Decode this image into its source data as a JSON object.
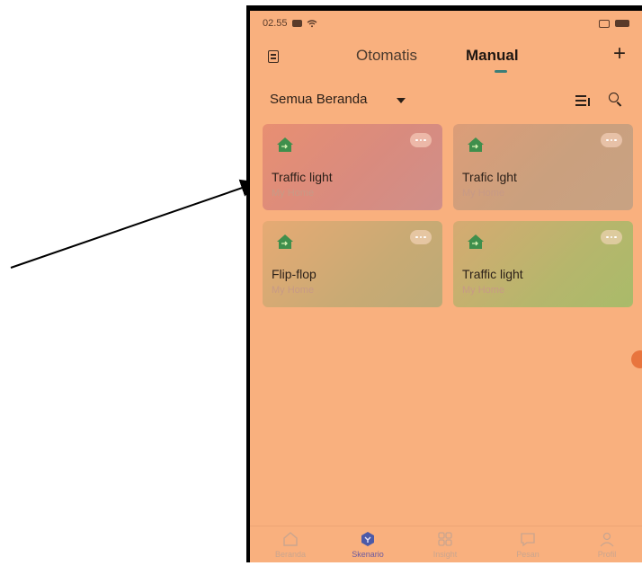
{
  "status_bar": {
    "time": "02.55"
  },
  "top_nav": {
    "tabs": [
      "Otomatis",
      "Manual"
    ],
    "active_tab": "Manual",
    "add_label": "+"
  },
  "filter": {
    "label": "Semua Beranda"
  },
  "cards": [
    {
      "title": "Traffic light",
      "subtitle": "My Home"
    },
    {
      "title": "Trafic lght",
      "subtitle": "My Home"
    },
    {
      "title": "Flip-flop",
      "subtitle": "My Home"
    },
    {
      "title": "Traffic light",
      "subtitle": "My Home"
    }
  ],
  "bottom_nav": {
    "items": [
      {
        "label": "Beranda",
        "icon": "home-icon"
      },
      {
        "label": "Skenario",
        "icon": "scenario-icon"
      },
      {
        "label": "Insight",
        "icon": "grid-icon"
      },
      {
        "label": "Pesan",
        "icon": "message-icon"
      },
      {
        "label": "Profil",
        "icon": "user-icon"
      }
    ],
    "active": "Skenario"
  },
  "colors": {
    "screen_bg": "#f9b07e",
    "accent_tab_indicator": "#3c7e78",
    "home_icon_green": "#3f8f4c",
    "active_nav": "#4b5aa8",
    "arrow": "#000000"
  }
}
